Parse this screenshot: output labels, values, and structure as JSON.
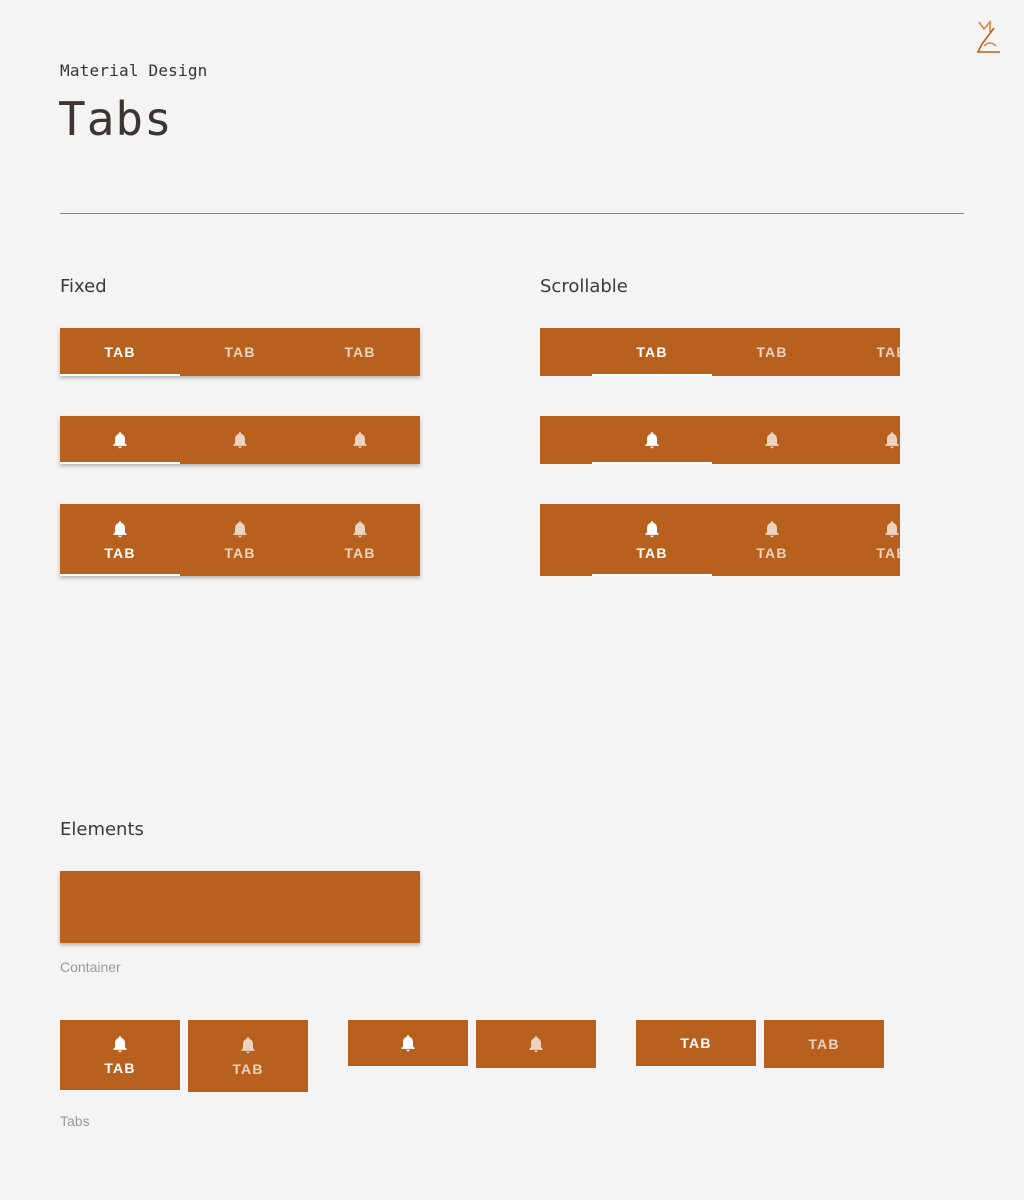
{
  "header": {
    "subtitle": "Material Design",
    "title": "Tabs"
  },
  "colors": {
    "container": "#b8601e",
    "indicator": "#ffffff",
    "background": "#f4f4f4"
  },
  "sections": {
    "fixed": "Fixed",
    "scrollable": "Scrollable",
    "elements": "Elements"
  },
  "tab_label": "TAB",
  "icon": "bell-icon",
  "captions": {
    "container": "Container",
    "tabs": "Tabs"
  }
}
